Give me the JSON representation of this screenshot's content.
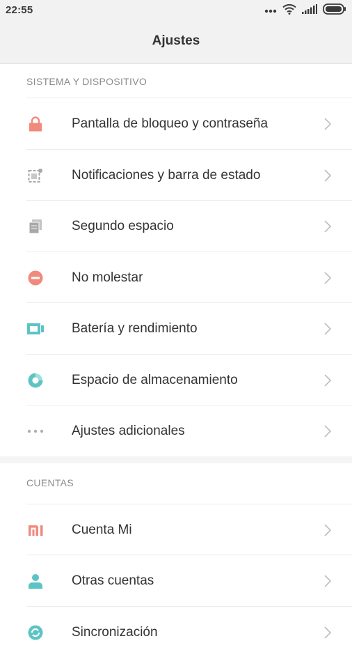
{
  "status_bar": {
    "time": "22:55"
  },
  "header": {
    "title": "Ajustes"
  },
  "sections": [
    {
      "title": "SISTEMA Y DISPOSITIVO",
      "items": [
        {
          "label": "Pantalla de bloqueo y contraseña",
          "icon": "lock-icon",
          "color": "#f08a7c"
        },
        {
          "label": "Notificaciones y barra de estado",
          "icon": "notification-icon",
          "color": "#a8a8a8"
        },
        {
          "label": "Segundo espacio",
          "icon": "second-space-icon",
          "color": "#a8a8a8"
        },
        {
          "label": "No molestar",
          "icon": "do-not-disturb-icon",
          "color": "#f08a7c"
        },
        {
          "label": "Batería y rendimiento",
          "icon": "battery-icon",
          "color": "#5cc4c4"
        },
        {
          "label": "Espacio de almacenamiento",
          "icon": "storage-icon",
          "color": "#5cc4c4"
        },
        {
          "label": "Ajustes adicionales",
          "icon": "more-icon",
          "color": "#a8a8a8"
        }
      ]
    },
    {
      "title": "CUENTAS",
      "items": [
        {
          "label": "Cuenta Mi",
          "icon": "mi-icon",
          "color": "#f08a7c"
        },
        {
          "label": "Otras cuentas",
          "icon": "person-icon",
          "color": "#5cc4c4"
        },
        {
          "label": "Sincronización",
          "icon": "sync-icon",
          "color": "#5cc4c4"
        }
      ]
    }
  ]
}
